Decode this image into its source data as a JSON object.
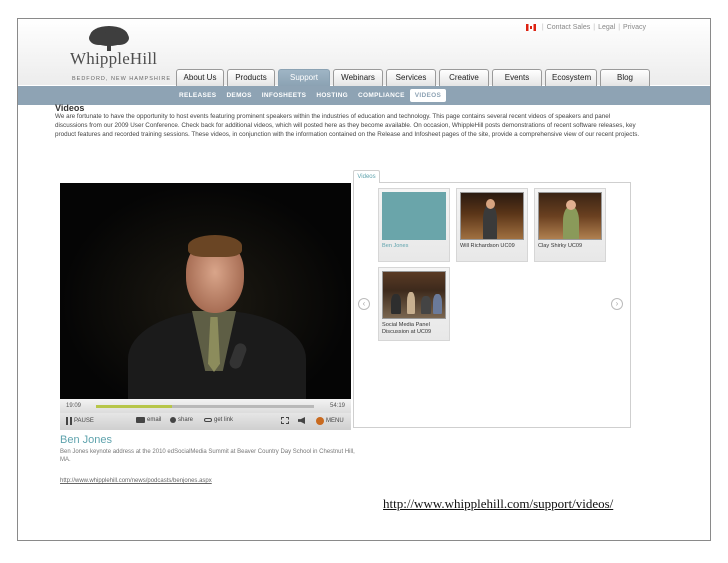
{
  "header": {
    "top_links": [
      "Contact Sales",
      "Legal",
      "Privacy"
    ],
    "logo_word": "WhippleHill",
    "logo_tagline": "BEDFORD, NEW HAMPSHIRE"
  },
  "nav": {
    "tabs": [
      "About Us",
      "Products",
      "Support",
      "Webinars",
      "Services",
      "Creative",
      "Events",
      "Ecosystem",
      "Blog"
    ],
    "active_tab": "Support",
    "subnav": [
      "RELEASES",
      "DEMOS",
      "INFOSHEETS",
      "HOSTING",
      "COMPLIANCE",
      "VIDEOS"
    ],
    "active_subnav": "VIDEOS"
  },
  "page": {
    "title": "Videos",
    "intro": "We are fortunate to have the opportunity to host events featuring prominent speakers within the industries of education and technology. This page contains several recent videos of speakers and panel discussions from our 2009 User Conference. Check back for additional videos, which will posted here as they become available. On occasion, WhippleHill posts demonstrations of recent software releases, key product features and recorded training sessions. These videos, in conjunction with the information contained on the Release and Infosheet pages of the site, provide a comprehensive view of our recent projects."
  },
  "player": {
    "current_time": "19:09",
    "duration": "54:19",
    "progress_fraction": 0.35,
    "controls": {
      "pause": "PAUSE",
      "email": "email",
      "share": "share",
      "get_link": "get link",
      "menu": "MENU"
    }
  },
  "video_info": {
    "title": "Ben Jones",
    "description": "Ben Jones keynote address at the 2010 edSocialMedia Summit at Beaver Country Day School in Chestnut Hill, MA.",
    "link": "http://www.whipplehill.com/news/podcasts/benjones.aspx"
  },
  "playlist": {
    "tab_label": "Videos",
    "items": [
      {
        "caption": "Ben Jones",
        "selected": true
      },
      {
        "caption": "Will Richardson UC09",
        "selected": false
      },
      {
        "caption": "Clay Shirky UC09",
        "selected": false
      },
      {
        "caption": "Social Media Panel Discussion at UC09",
        "selected": false
      }
    ],
    "prev_icon": "chevron-left-icon",
    "next_icon": "chevron-right-icon"
  },
  "slide_caption": "http://www.whipplehill.com/support/videos/",
  "colors": {
    "nav_bar": "#8ea3b4",
    "accent_teal": "#5fa3ad",
    "progress_fill": "#b7c64a"
  }
}
